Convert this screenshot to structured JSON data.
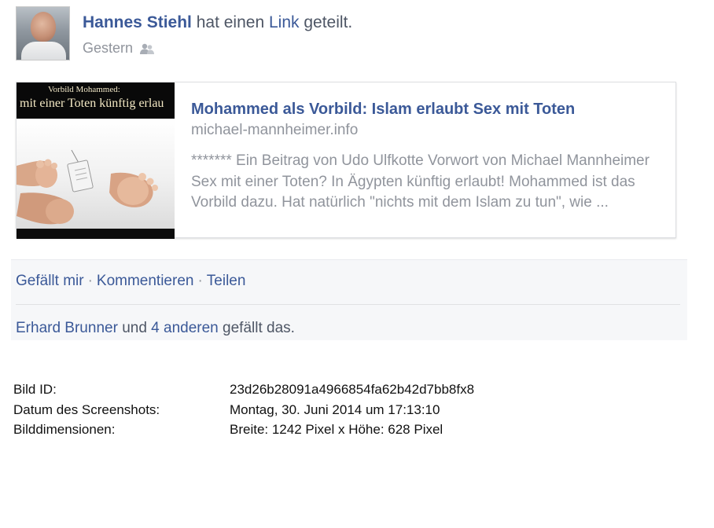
{
  "post": {
    "author": "Hannes Stiehl",
    "action_pre": "hat einen",
    "action_link": "Link",
    "action_post": "geteilt.",
    "time": "Gestern",
    "privacy_icon": "friends-icon"
  },
  "link_card": {
    "image_text_top": "Vorbild Mohammed:",
    "image_text_main": "mit einer Toten künftig erlau",
    "title": "Mohammed als Vorbild: Islam erlaubt Sex mit Toten",
    "domain": "michael-mannheimer.info",
    "description": "******* Ein Beitrag von Udo Ulfkotte Vorwort von Michael Mannheimer Sex mit einer Toten? In Ägypten künftig erlaubt! Mohammed ist das Vorbild dazu. Hat natürlich \"nichts mit dem Islam zu tun\", wie ..."
  },
  "actions": {
    "like": "Gefällt mir",
    "separator": "·",
    "comment": "Kommentieren",
    "share": "Teilen"
  },
  "likes": {
    "person": "Erhard Brunner",
    "connector": "und",
    "others": "4 anderen",
    "suffix": "gefällt das."
  },
  "info": {
    "rows": [
      {
        "label": "Bild ID:",
        "value": "23d26b28091a4966854fa62b42d7bb8fx8"
      },
      {
        "label": "Datum des Screenshots:",
        "value": "Montag, 30. Juni 2014 um 17:13:10"
      },
      {
        "label": "Bilddimensionen:",
        "value": "Breite: 1242 Pixel x Höhe: 628 Pixel"
      }
    ]
  },
  "colors": {
    "link_blue": "#3b5998",
    "muted_gray": "#90949c",
    "action_bg": "#f6f7f9"
  }
}
